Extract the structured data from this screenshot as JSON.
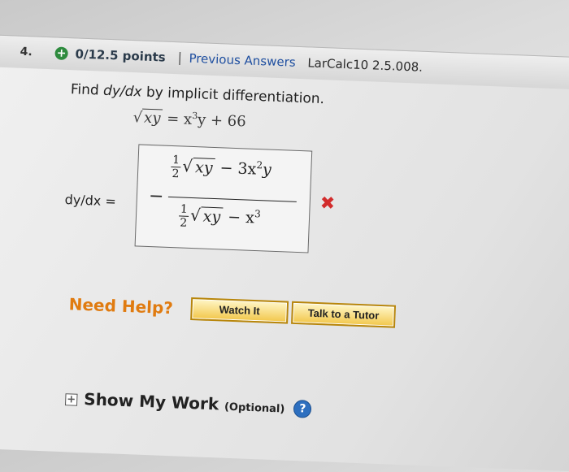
{
  "header": {
    "question_number": "4.",
    "points": "0/12.5 points",
    "separator": "|",
    "previous_answers": "Previous Answers",
    "source": "LarCalc10 2.5.008."
  },
  "question": {
    "prefix": "Find ",
    "dy_dx": "dy/dx",
    "suffix": " by implicit differentiation."
  },
  "equation": {
    "radicand": "xy",
    "equals": " = x",
    "exp": "3",
    "rest": "y + 66"
  },
  "answer": {
    "label": "dy/dx =",
    "minus": "−",
    "half_num": "1",
    "half_den": "2",
    "root_sym": "√",
    "radicand": "xy",
    "num_term": " − 3x",
    "num_exp": "2",
    "num_tail": "y",
    "den_term": " − x",
    "den_exp": "3",
    "status": "✖"
  },
  "help": {
    "label": "Need Help?",
    "watch_it": "Watch It",
    "talk_to_tutor": "Talk to a Tutor"
  },
  "show_work": {
    "toggle": "+",
    "label": "Show My Work",
    "optional": "(Optional)",
    "help_icon": "?"
  },
  "colors": {
    "points_icon": "#2e8b3e",
    "link": "#1f4fa0",
    "incorrect": "#d22c2c",
    "need_help": "#e07b10",
    "button_border": "#b8860b"
  }
}
